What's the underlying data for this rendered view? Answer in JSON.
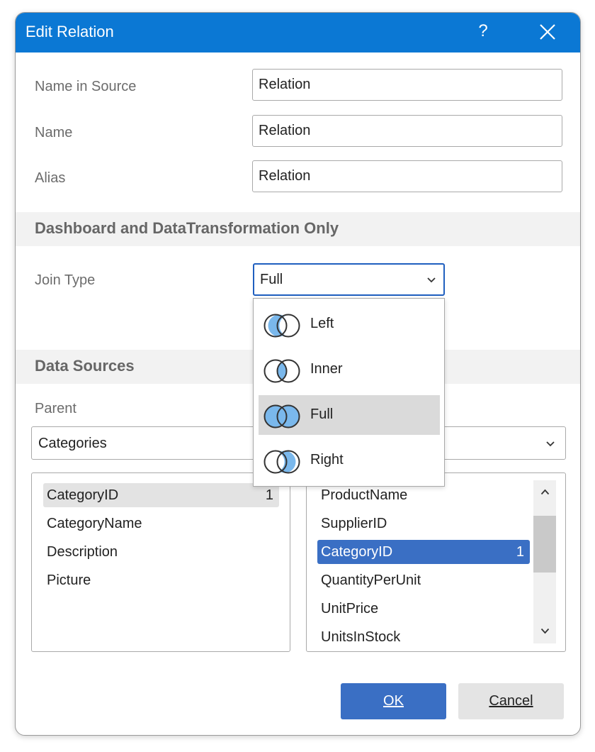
{
  "dialog": {
    "title": "Edit Relation",
    "help_label": "?"
  },
  "fields": {
    "name_in_source": {
      "label": "Name in Source",
      "value": "Relation"
    },
    "name": {
      "label": "Name",
      "value": "Relation"
    },
    "alias": {
      "label": "Alias",
      "value": "Relation"
    }
  },
  "dashboard_section": {
    "title": "Dashboard and DataTransformation Only",
    "join_type_label": "Join Type",
    "join_type_value": "Full",
    "options": [
      {
        "label": "Left",
        "icon": "left-join-icon"
      },
      {
        "label": "Inner",
        "icon": "inner-join-icon"
      },
      {
        "label": "Full",
        "icon": "full-join-icon",
        "selected": true
      },
      {
        "label": "Right",
        "icon": "right-join-icon"
      }
    ]
  },
  "data_sources": {
    "title": "Data Sources",
    "parent_label": "Parent",
    "parent_value": "Categories",
    "parent_columns": [
      {
        "name": "CategoryID",
        "badge": "1",
        "highlighted": true
      },
      {
        "name": "CategoryName"
      },
      {
        "name": "Description"
      },
      {
        "name": "Picture"
      }
    ],
    "child_columns": [
      {
        "name": "ProductName"
      },
      {
        "name": "SupplierID"
      },
      {
        "name": "CategoryID",
        "badge": "1",
        "selected": true
      },
      {
        "name": "QuantityPerUnit"
      },
      {
        "name": "UnitPrice"
      },
      {
        "name": "UnitsInStock"
      }
    ]
  },
  "buttons": {
    "ok": "OK",
    "cancel": "Cancel"
  },
  "colors": {
    "titlebar": "#0b78d4",
    "primary_button": "#3a6fc4",
    "selection": "#3a6fc4",
    "venn_fill": "#7ab8ec"
  }
}
